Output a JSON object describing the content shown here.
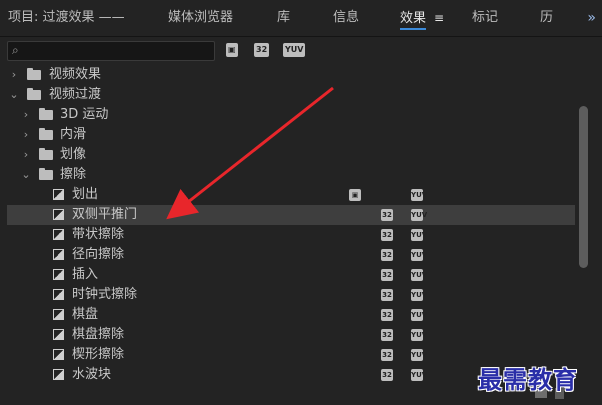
{
  "tabs": [
    {
      "label": "项目: 过渡效果 ——"
    },
    {
      "label": "媒体浏览器"
    },
    {
      "label": "库"
    },
    {
      "label": "信息"
    },
    {
      "label": "效果",
      "active": true
    },
    {
      "label": "标记"
    },
    {
      "label": "历"
    }
  ],
  "tab_menu_icon": "≡",
  "more_icon": "»",
  "search": {
    "value": "",
    "placeholder": ""
  },
  "toolbar_badges": {
    "accelerated": "▣",
    "bit32": "32",
    "yuv": "YUV"
  },
  "tree": [
    {
      "label": "视频效果",
      "type": "folder",
      "expanded": false,
      "level": 0
    },
    {
      "label": "视频过渡",
      "type": "folder",
      "expanded": true,
      "level": 0
    },
    {
      "label": "3D 运动",
      "type": "folder",
      "expanded": false,
      "level": 1
    },
    {
      "label": "内滑",
      "type": "folder",
      "expanded": false,
      "level": 1
    },
    {
      "label": "划像",
      "type": "folder",
      "expanded": false,
      "level": 1
    },
    {
      "label": "擦除",
      "type": "folder",
      "expanded": true,
      "level": 1
    },
    {
      "label": "划出",
      "type": "effect",
      "level": 2,
      "badges": [
        "acc",
        "yuv"
      ]
    },
    {
      "label": "双侧平推门",
      "type": "effect",
      "level": 2,
      "badges": [
        "32",
        "yuv"
      ],
      "selected": true
    },
    {
      "label": "带状擦除",
      "type": "effect",
      "level": 2,
      "badges": [
        "32",
        "yuv"
      ]
    },
    {
      "label": "径向擦除",
      "type": "effect",
      "level": 2,
      "badges": [
        "32",
        "yuv"
      ]
    },
    {
      "label": "插入",
      "type": "effect",
      "level": 2,
      "badges": [
        "32",
        "yuv"
      ]
    },
    {
      "label": "时钟式擦除",
      "type": "effect",
      "level": 2,
      "badges": [
        "32",
        "yuv"
      ]
    },
    {
      "label": "棋盘",
      "type": "effect",
      "level": 2,
      "badges": [
        "32",
        "yuv"
      ]
    },
    {
      "label": "棋盘擦除",
      "type": "effect",
      "level": 2,
      "badges": [
        "32",
        "yuv"
      ]
    },
    {
      "label": "楔形擦除",
      "type": "effect",
      "level": 2,
      "badges": [
        "32",
        "yuv"
      ]
    },
    {
      "label": "水波块",
      "type": "effect",
      "level": 2,
      "badges": [
        "32",
        "yuv"
      ]
    }
  ],
  "watermark": "最需教育",
  "colors": {
    "accent": "#3b8ad9",
    "arrow": "#e8262b",
    "watermark": "#2a2ea8",
    "selected_row": "#3e3e3e"
  }
}
